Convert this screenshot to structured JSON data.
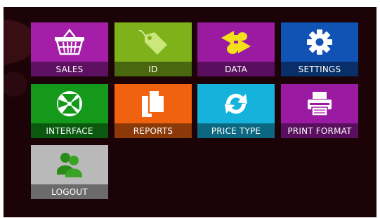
{
  "screen": {
    "background": "#1c0308"
  },
  "tiles": [
    {
      "label": "SALES",
      "color": "#a41ea8",
      "icon": "basket-icon"
    },
    {
      "label": "ID",
      "color": "#7fb11a",
      "icon": "tag-icon"
    },
    {
      "label": "DATA",
      "color": "#9a1aa1",
      "icon": "sync-arrows-icon"
    },
    {
      "label": "SETTINGS",
      "color": "#1152b5",
      "icon": "gear-icon"
    },
    {
      "label": "INTERFACE",
      "color": "#14991a",
      "icon": "aperture-icon"
    },
    {
      "label": "REPORTS",
      "color": "#f0620f",
      "icon": "documents-icon"
    },
    {
      "label": "PRICE TYPE",
      "color": "#15b3dc",
      "icon": "refresh-icon"
    },
    {
      "label": "PRINT FORMAT",
      "color": "#9a1aa1",
      "icon": "printer-icon"
    },
    {
      "label": "LOGOUT",
      "color": "#b9b9b9",
      "icon": "users-icon"
    }
  ]
}
